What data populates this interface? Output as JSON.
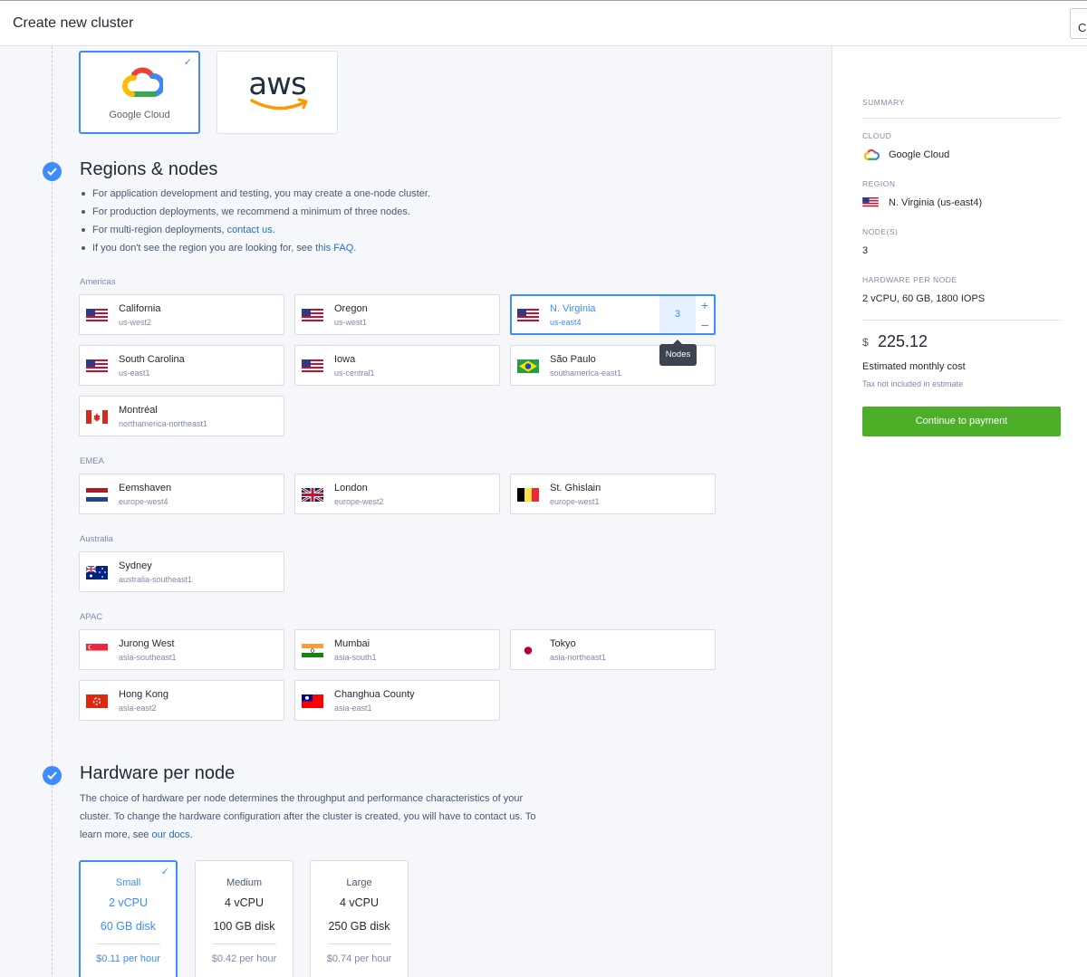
{
  "header": {
    "title": "Create new cluster",
    "cancel_label": "Cancel"
  },
  "cloud": {
    "options": [
      {
        "name": "Google Cloud",
        "selected": true
      },
      {
        "name": "aws",
        "selected": false
      }
    ]
  },
  "regions_section": {
    "title": "Regions & nodes",
    "bullets": [
      {
        "text": "For application development and testing, you may create a one-node cluster.",
        "link": "",
        "after": ""
      },
      {
        "text": "For production deployments, we recommend a minimum of three nodes.",
        "link": "",
        "after": ""
      },
      {
        "text": "For multi-region deployments, ",
        "link": "contact us",
        "after": "."
      },
      {
        "text": "If you don't see the region you are looking for, see ",
        "link": "this FAQ",
        "after": "."
      }
    ],
    "groups": {
      "americas": "Americas",
      "emea": "EMEA",
      "australia": "Australia",
      "apac": "APAC"
    },
    "regions": {
      "california": {
        "name": "California",
        "code": "us-west2",
        "flag": "us"
      },
      "oregon": {
        "name": "Oregon",
        "code": "us-west1",
        "flag": "us"
      },
      "nvirginia": {
        "name": "N. Virginia",
        "code": "us-east4",
        "flag": "us",
        "selected": true,
        "nodes": "3"
      },
      "southcarolina": {
        "name": "South Carolina",
        "code": "us-east1",
        "flag": "us"
      },
      "iowa": {
        "name": "Iowa",
        "code": "us-central1",
        "flag": "us"
      },
      "saopaulo": {
        "name": "São Paulo",
        "code": "southamerica-east1",
        "flag": "br"
      },
      "montreal": {
        "name": "Montréal",
        "code": "northamerica-northeast1",
        "flag": "ca"
      },
      "eemshaven": {
        "name": "Eemshaven",
        "code": "europe-west4",
        "flag": "nl"
      },
      "london": {
        "name": "London",
        "code": "europe-west2",
        "flag": "gb"
      },
      "stghislain": {
        "name": "St. Ghislain",
        "code": "europe-west1",
        "flag": "be"
      },
      "sydney": {
        "name": "Sydney",
        "code": "australia-southeast1",
        "flag": "au"
      },
      "jurongwest": {
        "name": "Jurong West",
        "code": "asia-southeast1",
        "flag": "sg"
      },
      "mumbai": {
        "name": "Mumbai",
        "code": "asia-south1",
        "flag": "in"
      },
      "tokyo": {
        "name": "Tokyo",
        "code": "asia-northeast1",
        "flag": "jp"
      },
      "hongkong": {
        "name": "Hong Kong",
        "code": "asia-east2",
        "flag": "hk"
      },
      "changhua": {
        "name": "Changhua County",
        "code": "asia-east1",
        "flag": "tw"
      }
    },
    "tooltip": "Nodes",
    "plus": "+",
    "minus": "–"
  },
  "hardware_section": {
    "title": "Hardware per node",
    "description": "The choice of hardware per node determines the throughput and performance characteristics of your cluster. To change the hardware configuration after the cluster is created, you will have to contact us. To learn more, see ",
    "link": "our docs",
    "after": ".",
    "options": [
      {
        "name": "Small",
        "cpu": "2 vCPU",
        "disk": "60 GB disk",
        "price": "$0.11 per hour",
        "selected": true
      },
      {
        "name": "Medium",
        "cpu": "4 vCPU",
        "disk": "100 GB disk",
        "price": "$0.42 per hour",
        "selected": false
      },
      {
        "name": "Large",
        "cpu": "4 vCPU",
        "disk": "250 GB disk",
        "price": "$0.74 per hour",
        "selected": false
      }
    ]
  },
  "summary": {
    "heading": "SUMMARY",
    "cloud_label": "CLOUD",
    "cloud_value": "Google Cloud",
    "region_label": "REGION",
    "region_value": "N. Virginia (us-east4)",
    "nodes_label": "NODE(S)",
    "nodes_value": "3",
    "hardware_label": "HARDWARE PER NODE",
    "hardware_value": "2 vCPU, 60 GB, 1800 IOPS",
    "currency": "$",
    "price": "225.12",
    "estimate_label": "Estimated monthly cost",
    "tax_note": "Tax not included in estimate",
    "continue_label": "Continue to payment"
  },
  "colors": {
    "accent": "#3d8bff",
    "pay_button": "#4caf27"
  }
}
